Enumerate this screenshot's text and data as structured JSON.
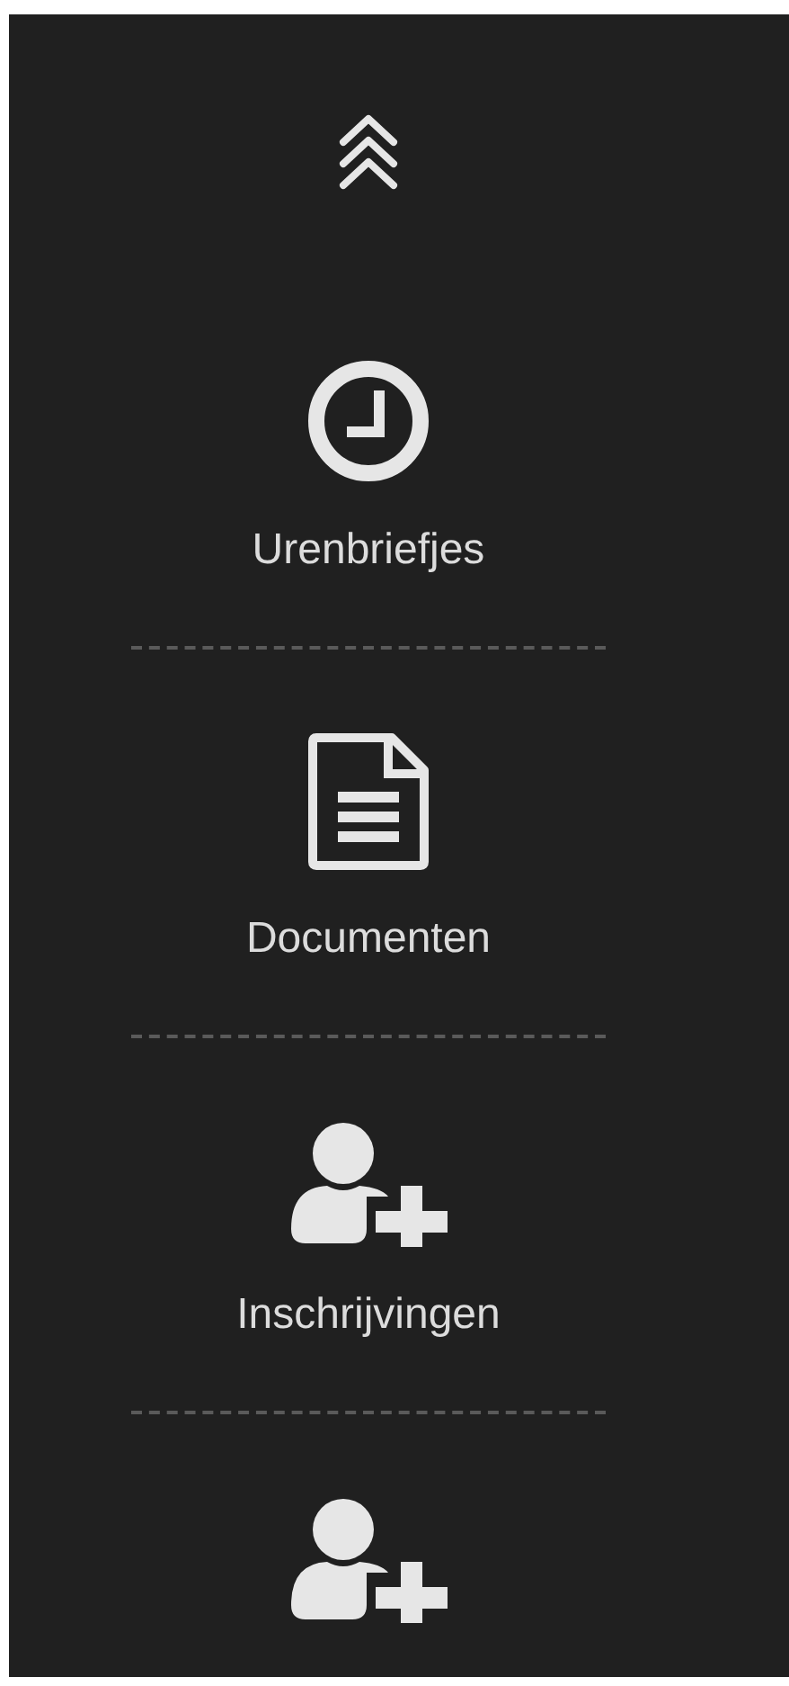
{
  "sidebar": {
    "collapse_toggle": {
      "kind": "chevrons-up"
    },
    "items": [
      {
        "kind": "clock",
        "label": "Urenbriefjes"
      },
      {
        "kind": "document",
        "label": "Documenten"
      },
      {
        "kind": "person-add",
        "label": "Inschrijvingen"
      },
      {
        "kind": "person-add"
      }
    ]
  }
}
